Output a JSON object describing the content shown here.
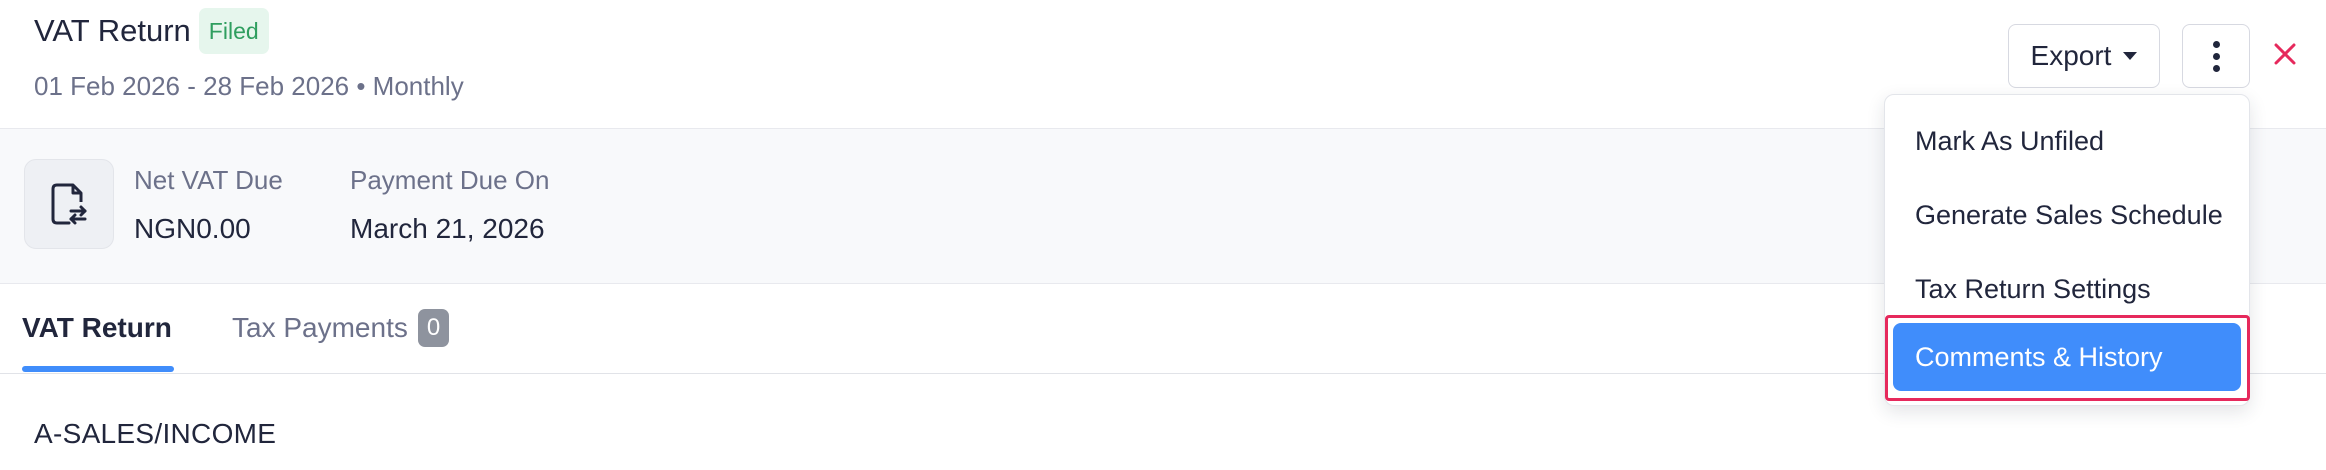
{
  "header": {
    "title": "VAT Return",
    "status_badge": "Filed",
    "period_text": "01 Feb 2026 - 28 Feb 2026 • Monthly",
    "export_label": "Export",
    "more_icon": "vertical-ellipsis-icon",
    "close_icon": "close-icon"
  },
  "summary": {
    "icon": "document-exchange-icon",
    "net_vat_label": "Net VAT Due",
    "net_vat_value": "NGN0.00",
    "payment_due_label": "Payment Due On",
    "payment_due_value": "March 21, 2026"
  },
  "tabs": [
    {
      "label": "VAT Return",
      "active": true
    },
    {
      "label": "Tax Payments",
      "count": "0",
      "active": false
    }
  ],
  "section": {
    "heading": "A-SALES/INCOME"
  },
  "dropdown": {
    "items": [
      {
        "label": "Mark As Unfiled"
      },
      {
        "label": "Generate Sales Schedule"
      },
      {
        "label": "Tax Return Settings"
      },
      {
        "label": "Comments & History",
        "highlighted": true
      }
    ]
  },
  "colors": {
    "accent": "#408dfb",
    "filed_badge_bg": "#e6f6ed",
    "filed_badge_text": "#2f9e5f",
    "close_icon": "#e6295c",
    "highlight_frame": "#e6295c"
  }
}
